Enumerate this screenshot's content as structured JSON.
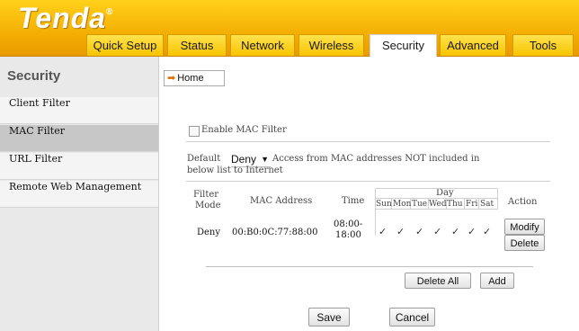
{
  "brand": {
    "logo": "Tenda",
    "mark": "®"
  },
  "nav": {
    "tabs": [
      "Quick Setup",
      "Status",
      "Network",
      "Wireless",
      "Security",
      "Advanced",
      "Tools"
    ],
    "active": "Security"
  },
  "sidebar": {
    "title": "Security",
    "items": [
      "Client Filter",
      "MAC Filter",
      "URL Filter",
      "Remote Web Management"
    ],
    "active": "MAC Filter"
  },
  "main": {
    "home_label": "Home",
    "enable_label": "Enable MAC Filter",
    "default_label": "Default",
    "default_value": "Deny",
    "default_desc_1": "Access from MAC addresses NOT included in",
    "default_desc_2": "below list to Internet",
    "table": {
      "headers": {
        "filter_mode_1": "Filter",
        "filter_mode_2": "Mode",
        "mac": "MAC Address",
        "time": "Time",
        "day": "Day",
        "action": "Action"
      },
      "days": [
        "Sun",
        "Mon",
        "Tue",
        "Wed",
        "Thu",
        "Fri",
        "Sat"
      ],
      "rows": [
        {
          "mode": "Deny",
          "mac": "00:B0:0C:77:88:00",
          "time_start": "08:00-",
          "time_end": "18:00",
          "ticks": [
            "✓",
            "✓",
            "✓",
            "✓",
            "✓",
            "✓",
            "✓"
          ],
          "modify": "Modify",
          "delete": "Delete"
        }
      ]
    },
    "delete_all": "Delete All",
    "add": "Add",
    "save": "Save",
    "cancel": "Cancel"
  },
  "colors": {
    "header": "#f7c400",
    "sidebar_active": "#c7c7c7"
  }
}
